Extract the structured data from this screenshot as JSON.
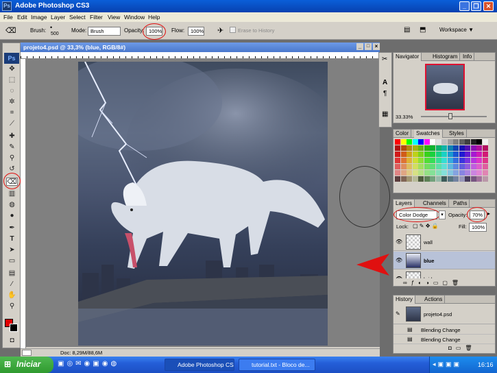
{
  "window": {
    "title": "Adobe Photoshop CS3",
    "ps_label": "Ps",
    "minimize": "_",
    "maximize": "❐",
    "close": "✕"
  },
  "menu": [
    "File",
    "Edit",
    "Image",
    "Layer",
    "Select",
    "Filter",
    "View",
    "Window",
    "Help"
  ],
  "options": {
    "brush_label": "Brush:",
    "brush_size": "500",
    "mode_label": "Mode:",
    "mode_value": "Brush",
    "opacity_label": "Opacity:",
    "opacity_value": "100%",
    "flow_label": "Flow:",
    "flow_value": "100%",
    "erase_to_history": "Erase to History",
    "workspace": "Workspace ▼"
  },
  "document": {
    "title": "projeto4.psd @ 33,3% (blue, RGB/8#)",
    "status": "Doc: 8,29M/88,6M"
  },
  "toolbox": {
    "logo": "Ps"
  },
  "navigator": {
    "tabs": [
      "Navigator",
      "Histogram",
      "Info"
    ],
    "zoom": "33.33%"
  },
  "swatches": {
    "tabs": [
      "Color",
      "Swatches",
      "Styles"
    ]
  },
  "layers": {
    "tabs": [
      "Layers",
      "Channels",
      "Paths"
    ],
    "blend_mode": "Color Dodge",
    "opacity_label": "Opacity:",
    "opacity_value": "70%",
    "lock_label": "Lock:",
    "fill_label": "Fill:",
    "fill_value": "100%",
    "items": [
      {
        "name": "wall"
      },
      {
        "name": "blue"
      },
      {
        "name": "bridge"
      }
    ]
  },
  "history": {
    "tabs": [
      "History",
      "Actions"
    ],
    "items": [
      {
        "name": "projeto4.psd"
      },
      {
        "name": "Blending Change"
      },
      {
        "name": "Blending Change"
      }
    ]
  },
  "taskbar": {
    "start": "Iniciar",
    "tasks": [
      "Adobe Photoshop CS...",
      "tutorial.txt - Bloco de..."
    ],
    "time": "16:16"
  },
  "colors": {
    "selected_layer": "#b8c2d8",
    "annotation": "#e01010",
    "foreground": "#e00000",
    "background": "#000000"
  }
}
